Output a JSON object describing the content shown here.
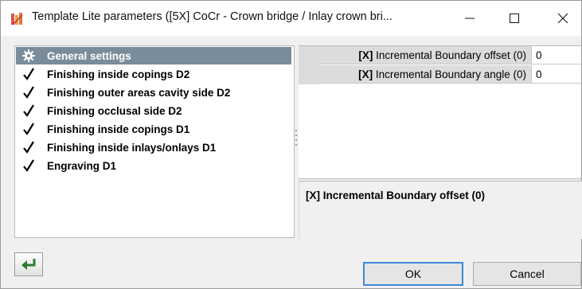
{
  "window": {
    "title": "Template Lite parameters ([5X] CoCr - Crown bridge / Inlay crown bri..."
  },
  "tree": {
    "items": [
      {
        "label": "General settings",
        "icon": "gear-icon",
        "selected": true
      },
      {
        "label": "Finishing inside copings D2",
        "icon": "checkmark-icon"
      },
      {
        "label": "Finishing outer areas cavity side D2",
        "icon": "checkmark-icon"
      },
      {
        "label": "Finishing occlusal side D2",
        "icon": "checkmark-icon"
      },
      {
        "label": "Finishing inside copings D1",
        "icon": "checkmark-icon"
      },
      {
        "label": "Finishing inside inlays/onlays D1",
        "icon": "checkmark-icon"
      },
      {
        "label": "Engraving D1",
        "icon": "checkmark-icon"
      }
    ]
  },
  "grid": {
    "rows": [
      {
        "prefix": "[X]",
        "name": " Incremental Boundary offset (0)",
        "value": "0"
      },
      {
        "prefix": "[X]",
        "name": " Incremental Boundary angle (0)",
        "value": "0"
      }
    ]
  },
  "description": {
    "prefix": "[X]",
    "text": " Incremental Boundary offset (0)"
  },
  "buttons": {
    "ok": "OK",
    "cancel": "Cancel"
  },
  "colors": {
    "selection": "#7a8c9a",
    "accent_border": "#3c8ad8",
    "back_arrow": "#2e7d32"
  }
}
